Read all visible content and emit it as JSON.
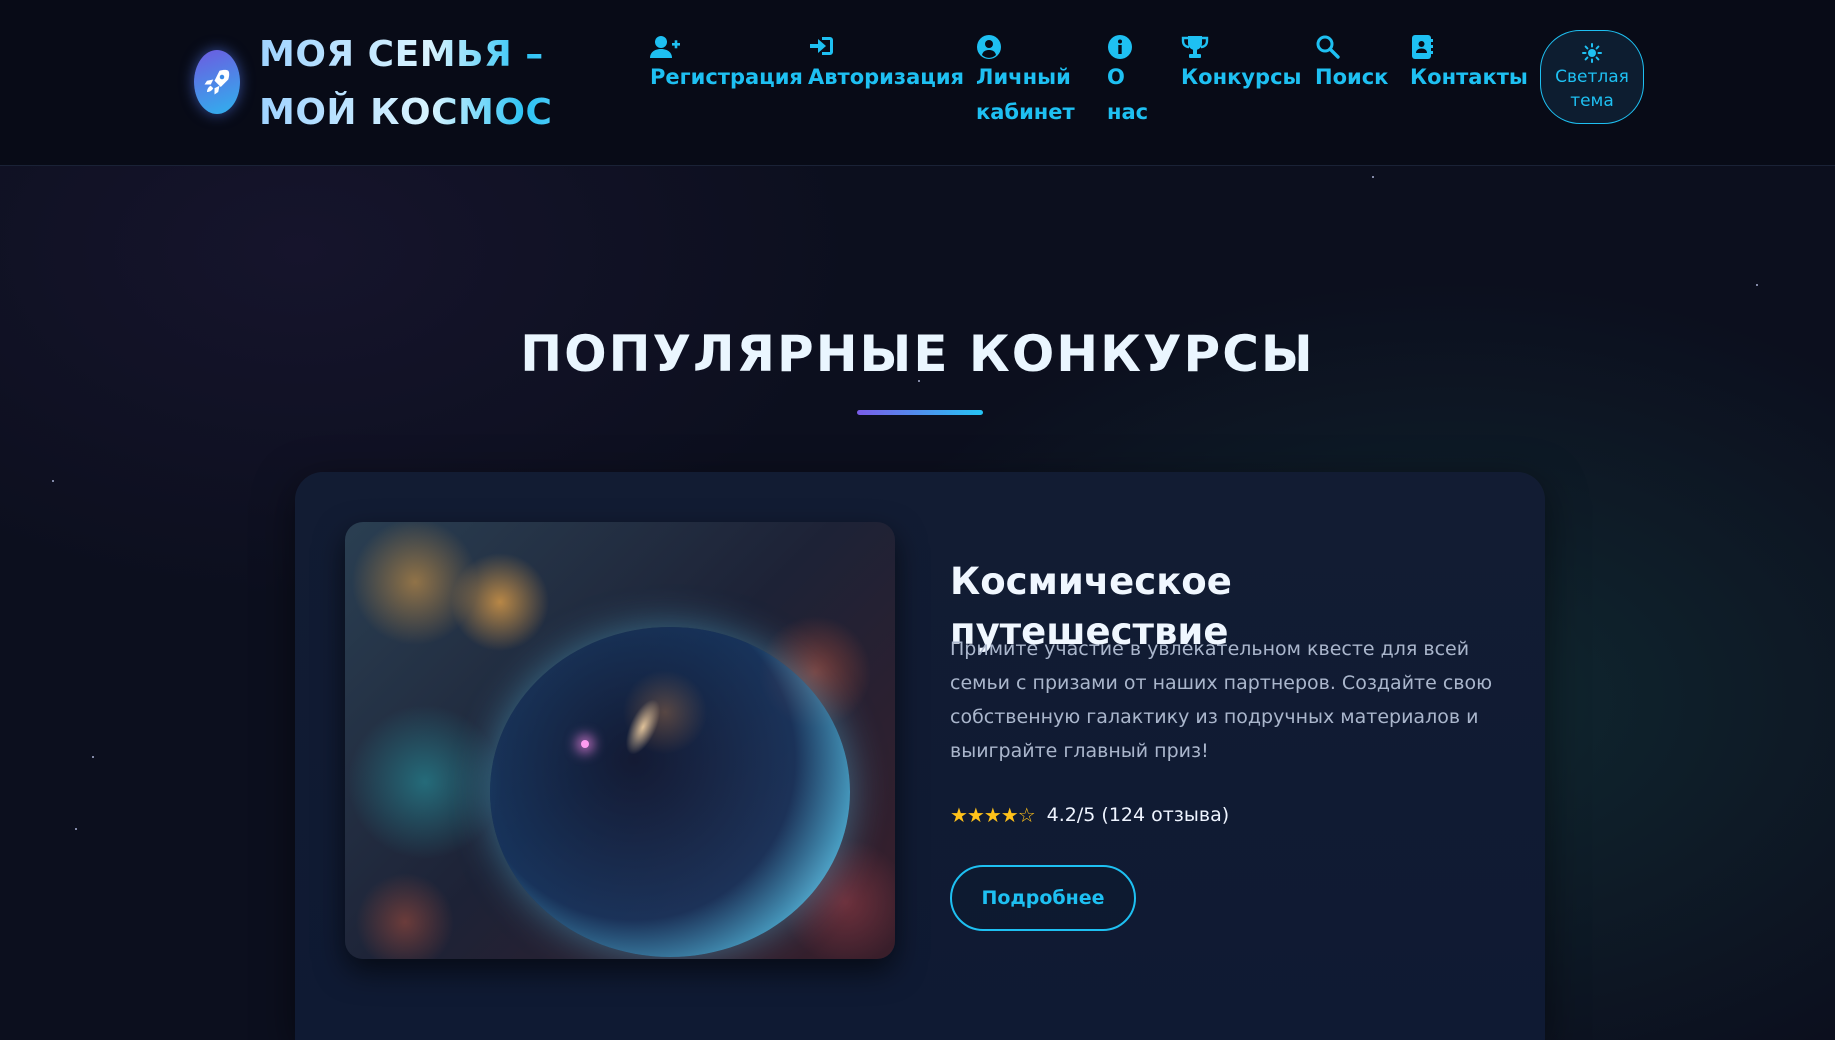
{
  "header": {
    "brand": "МОЯ СЕМЬЯ – МОЙ КОСМОС",
    "nav": [
      {
        "label": "Регистрация",
        "icon": "user-plus-icon"
      },
      {
        "label": "Авторизация",
        "icon": "sign-in-icon"
      },
      {
        "label": "Личный кабинет",
        "icon": "user-circle-icon"
      },
      {
        "label": "О нас",
        "icon": "info-circle-icon"
      },
      {
        "label": "Конкурсы",
        "icon": "trophy-icon"
      },
      {
        "label": "Поиск",
        "icon": "search-icon"
      },
      {
        "label": "Контакты",
        "icon": "address-book-icon"
      }
    ],
    "theme_button": "Светлая тема"
  },
  "section": {
    "title": "ПОПУЛЯРНЫЕ КОНКУРСЫ"
  },
  "contest": {
    "title": "Космическое путешествие",
    "description": "Примите участие в увлекательном квесте для всей семьи с призами от наших партнеров. Создайте свою собственную галактику из подручных материалов и выиграйте главный приз!",
    "stars": "★★★★☆",
    "rating_text": "4.2/5 (124 отзыва)",
    "button": "Подробнее"
  },
  "colors": {
    "accent": "#1ec0f2",
    "gradient_start": "#7a5ce8",
    "star_color": "#ffc21a",
    "background": "#0c0f1e"
  }
}
